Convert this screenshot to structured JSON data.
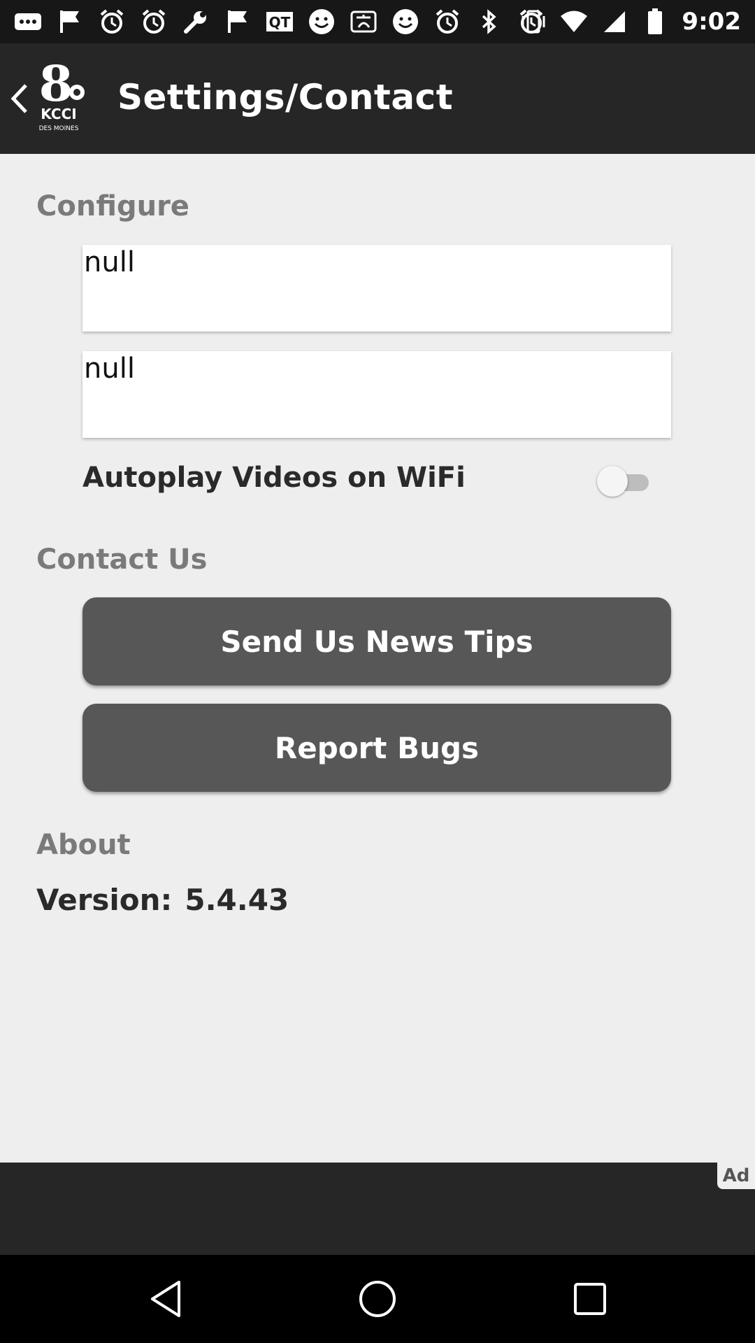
{
  "status_bar": {
    "time": "9:02",
    "icons": [
      "more-dots-icon",
      "flag-icon",
      "alarm-icon",
      "alarm-icon",
      "wrench-icon",
      "flag-icon",
      "qt-icon",
      "smiley-icon",
      "translate-icon",
      "smiley-icon",
      "alarm-icon",
      "bluetooth-icon",
      "alarm-icon",
      "vibrate-icon",
      "wifi-icon",
      "signal-icon",
      "battery-icon"
    ]
  },
  "app_bar": {
    "title": "Settings/Contact",
    "logo_text": "KCCI",
    "logo_subtext": "DES MOINES",
    "logo_number": "8"
  },
  "configure": {
    "header": "Configure",
    "field1_value": "null",
    "field2_value": "null",
    "autoplay_label": "Autoplay Videos on WiFi",
    "autoplay_enabled": false
  },
  "contact": {
    "header": "Contact Us",
    "news_tips_label": "Send Us News Tips",
    "report_bugs_label": "Report Bugs"
  },
  "about": {
    "header": "About",
    "version_label": "Version:",
    "version_value": "5.4.43"
  },
  "ad": {
    "badge": "Ad"
  },
  "colors": {
    "app_bar": "#262626",
    "background": "#eeeeee",
    "button": "#575757",
    "section_header": "#7a7a7a"
  }
}
